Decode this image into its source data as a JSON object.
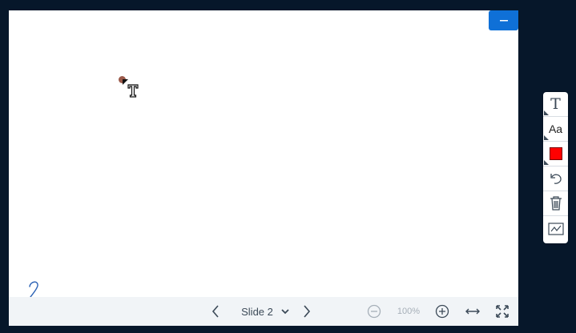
{
  "presentation": {
    "minimize_icon": "minus-icon",
    "slide_number_text": "2"
  },
  "bottom_bar": {
    "prev_icon": "chevron-left-icon",
    "slide_label": "Slide 2",
    "dropdown_icon": "chevron-down-icon",
    "next_icon": "chevron-right-icon",
    "zoom_out_icon": "zoom-out-icon",
    "zoom_value": "100%",
    "zoom_in_icon": "zoom-in-icon",
    "fit_width_icon": "fit-width-icon",
    "fullscreen_icon": "fullscreen-icon"
  },
  "toolbar": {
    "tools": [
      {
        "icon": "text-tool-icon",
        "glyph": "T"
      },
      {
        "icon": "font-size-icon",
        "glyph": "Aa"
      },
      {
        "icon": "color-picker-icon",
        "color": "#ff0000"
      },
      {
        "icon": "undo-icon"
      },
      {
        "icon": "trash-icon"
      },
      {
        "icon": "whiteboard-icon"
      }
    ]
  },
  "colors": {
    "background": "#06172a",
    "accent": "#0f70d7",
    "selected_color": "#ff0000"
  }
}
